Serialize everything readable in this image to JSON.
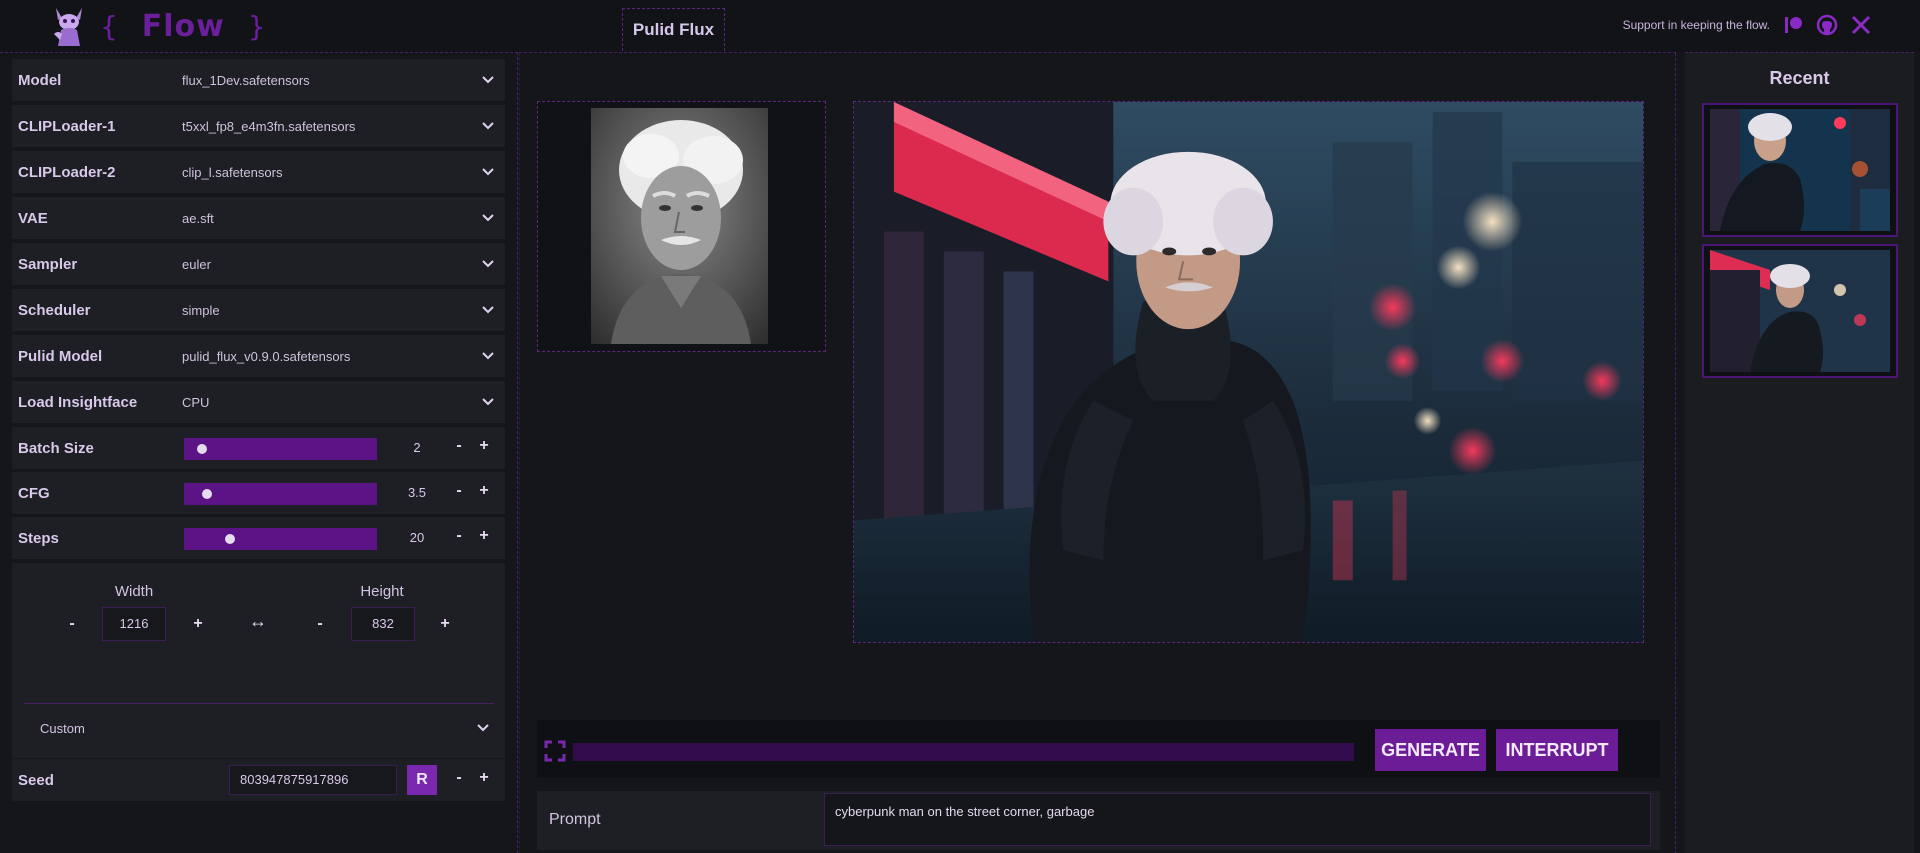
{
  "header": {
    "logo_text": "Flow",
    "brace_open": "{",
    "brace_close": "}",
    "app_tab": "Pulid Flux",
    "support_text": "Support in keeping the flow.",
    "social_icons": [
      "patreon-icon",
      "github-icon",
      "x-icon"
    ]
  },
  "settings": {
    "model": {
      "label": "Model",
      "value": "flux_1Dev.safetensors"
    },
    "clip1": {
      "label": "CLIPLoader-1",
      "value": "t5xxl_fp8_e4m3fn.safetensors"
    },
    "clip2": {
      "label": "CLIPLoader-2",
      "value": "clip_l.safetensors"
    },
    "vae": {
      "label": "VAE",
      "value": "ae.sft"
    },
    "sampler": {
      "label": "Sampler",
      "value": "euler"
    },
    "scheduler": {
      "label": "Scheduler",
      "value": "simple"
    },
    "pulid": {
      "label": "Pulid Model",
      "value": "pulid_flux_v0.9.0.safetensors"
    },
    "insightface": {
      "label": "Load Insightface",
      "value": "CPU"
    },
    "batch": {
      "label": "Batch Size",
      "value": "2",
      "level": 0.04
    },
    "cfg": {
      "label": "CFG",
      "value": "3.5",
      "level": 0.07
    },
    "steps": {
      "label": "Steps",
      "value": "20",
      "level": 0.2
    },
    "minus": "-",
    "plus": "+",
    "width_label": "Width",
    "width_value": "1216",
    "height_label": "Height",
    "height_value": "832",
    "swap_symbol": "↔",
    "preset": "Custom",
    "seed": {
      "label": "Seed",
      "value": "803947875917896",
      "random_btn": "R"
    }
  },
  "actions": {
    "generate": "GENERATE",
    "interrupt": "INTERRUPT",
    "progress": 0
  },
  "prompt": {
    "label": "Prompt",
    "text": "cyberpunk man on the street corner, garbage"
  },
  "recent": {
    "title": "Recent"
  },
  "colors": {
    "accent": "#6d1c97",
    "slider": "#5c1385",
    "progress_track": "#330c4d",
    "logo": "#6b1f9a"
  }
}
